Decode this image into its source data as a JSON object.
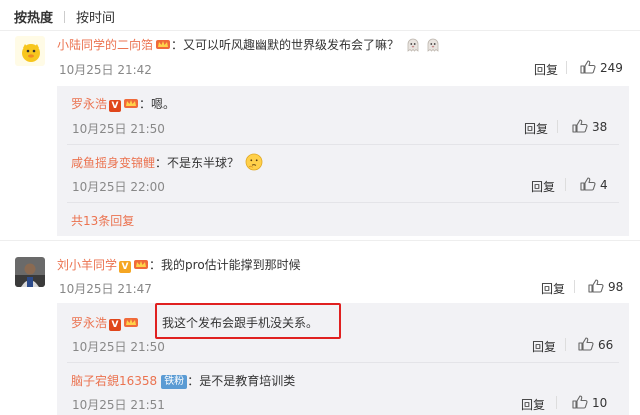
{
  "tabs": {
    "hot": "按热度",
    "time": "按时间"
  },
  "comments": [
    {
      "user": "小陆同学的二向箔",
      "text": "又可以听风趣幽默的世界级发布会了嘛？",
      "time": "10月25日 21:42",
      "reply_label": "回复",
      "likes": "249",
      "replies": [
        {
          "user": "罗永浩",
          "text": "嗯。",
          "time": "10月25日 21:50",
          "reply_label": "回复",
          "likes": "38"
        },
        {
          "user": "咸鱼摇身变锦鲤",
          "text": "不是东半球？",
          "time": "10月25日 22:00",
          "reply_label": "回复",
          "likes": "4"
        }
      ],
      "more_replies": "共13条回复"
    },
    {
      "user": "刘小羊同学",
      "text": "我的pro估计能撑到那时候",
      "time": "10月25日 21:47",
      "reply_label": "回复",
      "likes": "98",
      "replies": [
        {
          "user": "罗永浩",
          "text": "我这个发布会跟手机没关系。",
          "time": "10月25日 21:50",
          "reply_label": "回复",
          "likes": "66"
        },
        {
          "user": "脑子宕鋧16358",
          "badge": "铁粉",
          "text": "是不是教育培训类",
          "time": "10月25日 21:51",
          "reply_label": "回复",
          "likes": "10"
        }
      ]
    }
  ],
  "colors": {
    "username": "#eb7350",
    "highlight": "#e02020",
    "reply_bg": "#f2f2f5",
    "fan_badge": "#5a9bd4"
  },
  "icons": [
    "thumbs-up-icon",
    "verified-v-icon",
    "crown-icon",
    "ghost-emoji-icon",
    "thinking-emoji-icon"
  ]
}
